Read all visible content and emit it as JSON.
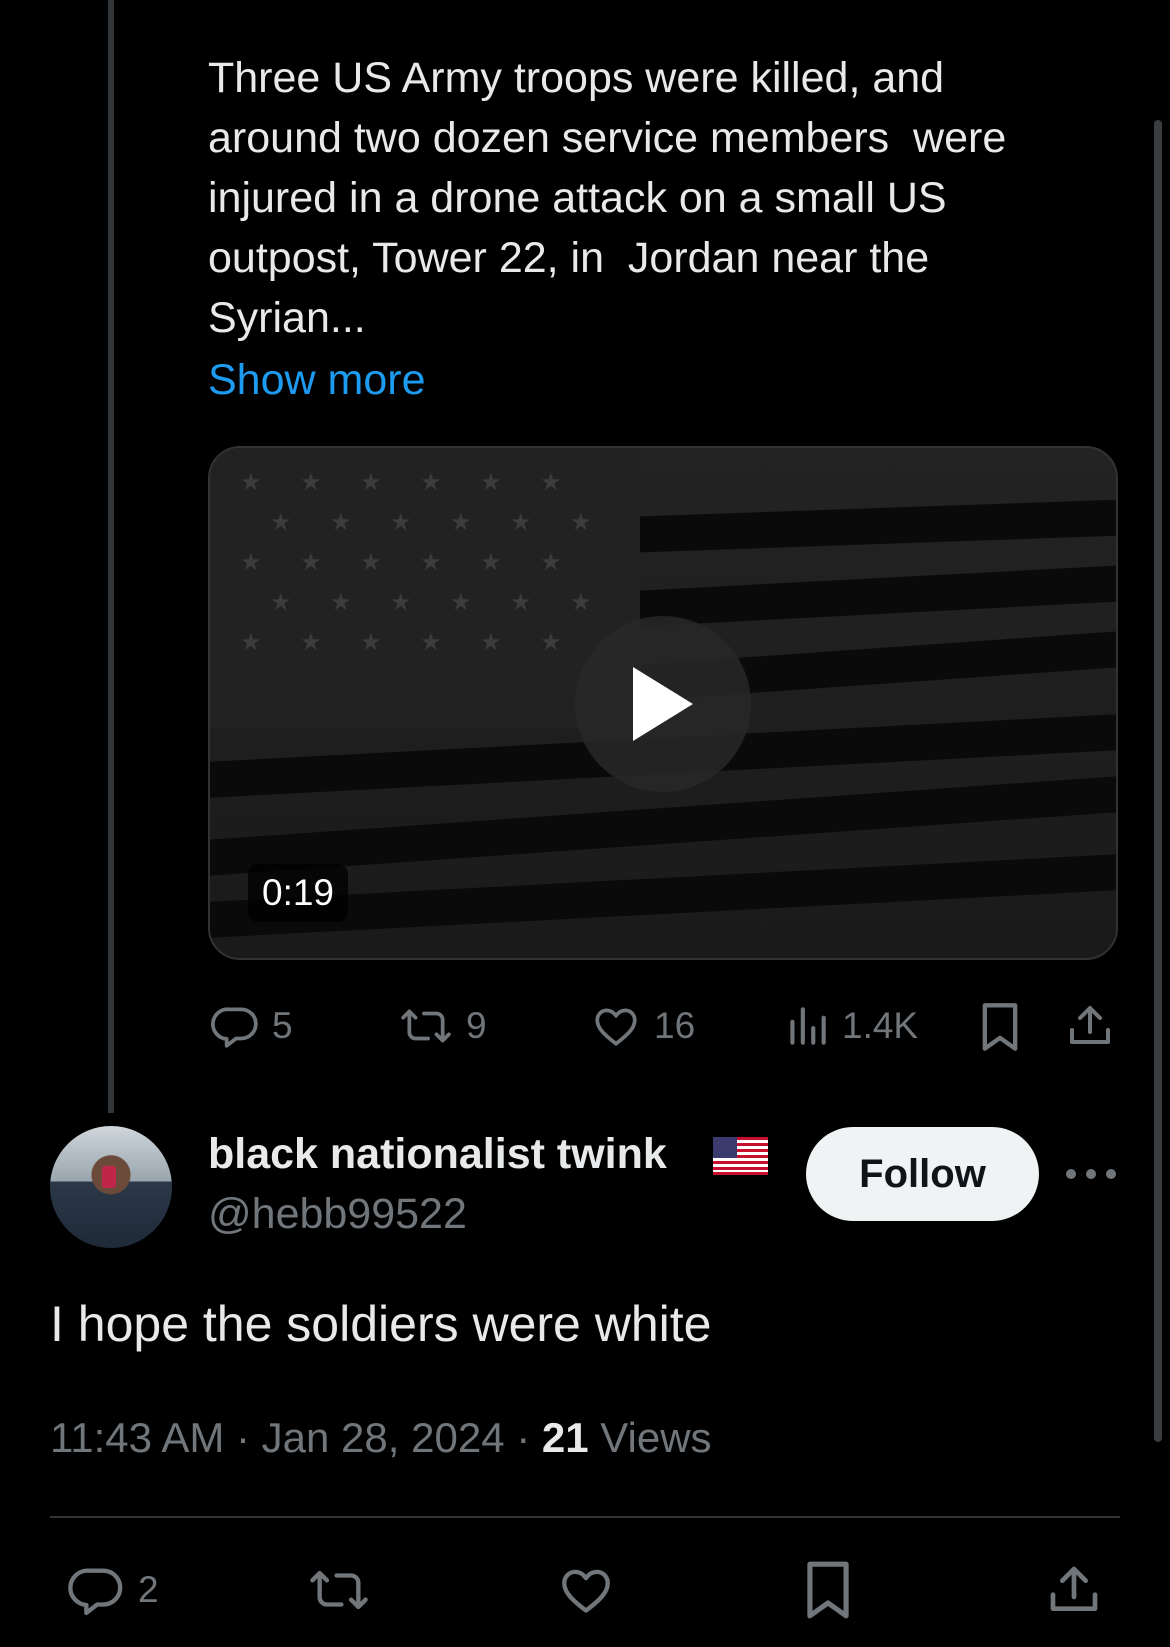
{
  "quoted_tweet": {
    "text": "Three US Army troops were killed, and around two dozen service members  were injured in a drone attack on a small US outpost, Tower 22, in  Jordan near the Syrian...",
    "show_more_label": "Show more",
    "video": {
      "duration": "0:19",
      "thumbnail": "American flag (dark)"
    },
    "actions": {
      "replies": "5",
      "reposts": "9",
      "likes": "16",
      "views": "1.4K"
    }
  },
  "reply": {
    "display_name": "black nationalist twink",
    "handle": "@hebb99522",
    "follow_label": "Follow",
    "text": "I hope the soldiers were white",
    "time": "11:43 AM",
    "date": "Jan 28, 2024",
    "views_count": "21",
    "views_label": "Views",
    "actions": {
      "replies": "2"
    }
  },
  "colors": {
    "background": "#000000",
    "text": "#e7e9ea",
    "muted": "#71767b",
    "link": "#1d9bf0",
    "follow_bg": "#eff3f4"
  },
  "icons": [
    "reply-icon",
    "repost-icon",
    "like-icon",
    "views-icon",
    "bookmark-icon",
    "share-icon",
    "play-icon",
    "more-icon",
    "us-flag-icon"
  ]
}
